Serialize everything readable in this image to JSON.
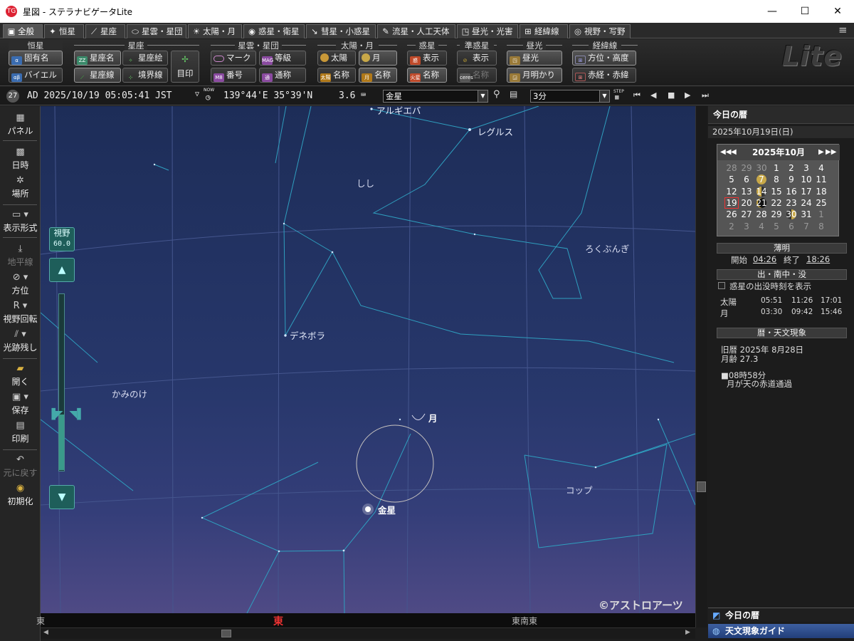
{
  "window": {
    "title": "星図 - ステラナビゲータLite",
    "app_icon": "TG",
    "minimize": "—",
    "maximize": "☐",
    "close": "✕",
    "menu_icon": "≡"
  },
  "tabs": [
    {
      "label": "全般",
      "icon": "▣"
    },
    {
      "label": "恒星",
      "icon": "✦"
    },
    {
      "label": "星座",
      "icon": "⟋"
    },
    {
      "label": "星雲・星団",
      "icon": "⬭"
    },
    {
      "label": "太陽・月",
      "icon": "☀"
    },
    {
      "label": "惑星・衛星",
      "icon": "◉"
    },
    {
      "label": "彗星・小惑星",
      "icon": "↘"
    },
    {
      "label": "流星・人工天体",
      "icon": "✎"
    },
    {
      "label": "昼光・光害",
      "icon": "◳"
    },
    {
      "label": "経緯線",
      "icon": "⊞"
    },
    {
      "label": "視野・写野",
      "icon": "◎"
    }
  ],
  "ribbon": {
    "groups": {
      "star": "恒星",
      "constellation": "星座",
      "nebula": "星雲・星団",
      "sunmoon": "太陽・月",
      "planet": "惑星",
      "dwarf": "準惑星",
      "daylight": "昼光",
      "grid": "経緯線"
    },
    "buttons": {
      "proper_name": "固有名",
      "bayer": "バイエル",
      "const_name": "星座名",
      "const_line": "星座線",
      "const_art": "星座絵",
      "boundary": "境界線",
      "mejirushi": "目印",
      "mark": "マーク",
      "magnitude": "等級",
      "number": "番号",
      "common_name": "通称",
      "sun": "太陽",
      "moon": "月",
      "sun_name": "名称",
      "moon_name": "名称",
      "planet_show": "表示",
      "planet_name": "名称",
      "dwarf_show": "表示",
      "dwarf_name": "名称",
      "daylight": "昼光",
      "moonlight": "月明かり",
      "altaz": "方位・高度",
      "radec": "赤経・赤緯"
    },
    "logo": "Lite"
  },
  "status": {
    "day_badge": "27",
    "datetime": "AD 2025/10/19 05:05:41 JST",
    "tz_arrow": "▽",
    "now_label": "NOW",
    "location": "139°44'E 35°39'N",
    "magnitude": "3.6",
    "search_value": "金星",
    "step_value": "3分",
    "step_label": "STEP"
  },
  "leftbar": {
    "panel": "パネル",
    "datetime": "日時",
    "location": "場所",
    "display": "表示形式",
    "horizon": "地平線",
    "direction": "方位",
    "rotate": "視野回転",
    "trail": "光跡残し",
    "open": "開く",
    "save": "保存",
    "print": "印刷",
    "undo": "元に戻す",
    "reset": "初期化",
    "fov_label": "視野",
    "fov_value": "60.0"
  },
  "sky": {
    "labels": {
      "algieba": "アルギエバ",
      "regulus": "レグルス",
      "leo": "しし",
      "sextans": "ろくぶんぎ",
      "denebola": "デネボラ",
      "coma": "かみのけ",
      "moon": "月",
      "venus": "金星",
      "crater": "コップ"
    },
    "copyright": "©アストロアーツ",
    "horizon_labels": {
      "left": "東",
      "center": "東",
      "right": "東南東"
    }
  },
  "rpanel": {
    "title": "今日の暦",
    "date": "2025年10月19日(日)",
    "calendar": {
      "month_label": "2025年10月",
      "weeks": [
        [
          "28",
          "29",
          "30",
          "1",
          "2",
          "3",
          "4"
        ],
        [
          "5",
          "6",
          "7",
          "8",
          "9",
          "10",
          "11"
        ],
        [
          "12",
          "13",
          "14",
          "15",
          "16",
          "17",
          "18"
        ],
        [
          "19",
          "20",
          "21",
          "22",
          "23",
          "24",
          "25"
        ],
        [
          "26",
          "27",
          "28",
          "29",
          "30",
          "31",
          "1"
        ],
        [
          "2",
          "3",
          "4",
          "5",
          "6",
          "7",
          "8"
        ]
      ]
    },
    "twilight": {
      "header": "薄明",
      "start_label": "開始",
      "start": "04:26",
      "end_label": "終了",
      "end": "18:26"
    },
    "rise": {
      "header": "出・南中・没",
      "checkbox_label": "惑星の出没時刻を表示",
      "rows": [
        {
          "name": "太陽",
          "rise": "05:51",
          "transit": "11:26",
          "set": "17:01"
        },
        {
          "name": "月",
          "rise": "03:30",
          "transit": "09:42",
          "set": "15:46"
        }
      ]
    },
    "events": {
      "header": "暦・天文現象",
      "old_calendar": "旧暦 2025年 8月28日",
      "moon_age": "月齢 27.3",
      "event_time": "■08時58分",
      "event_text": "月が天の赤道通過"
    },
    "bottom_tabs": [
      "今日の暦",
      "天文現象ガイド"
    ]
  },
  "colors": {
    "sky_top": "#1d2d58",
    "sky_bottom": "#4f4a85",
    "const_line": "#3aa8c8",
    "grid": "#3c4a80",
    "today_border": "#ee3333"
  }
}
